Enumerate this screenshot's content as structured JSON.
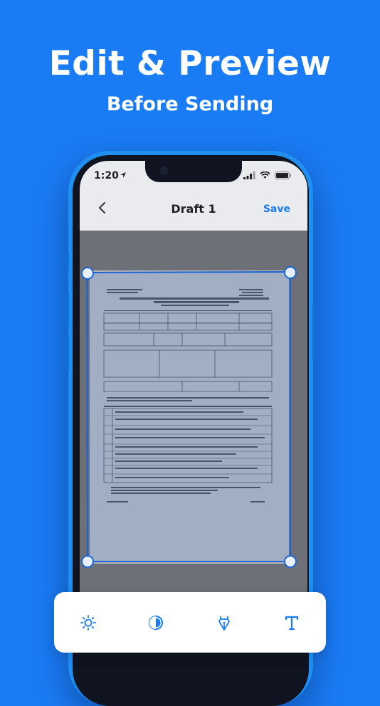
{
  "hero": {
    "title": "Edit & Preview",
    "subtitle": "Before Sending"
  },
  "status_bar": {
    "time": "1:20"
  },
  "nav": {
    "title": "Draft 1",
    "save_label": "Save"
  },
  "toolbar": {
    "tools": [
      {
        "icon": "brightness-icon"
      },
      {
        "icon": "contrast-icon"
      },
      {
        "icon": "pen-icon"
      },
      {
        "icon": "text-icon"
      }
    ]
  },
  "colors": {
    "background": "#1a7cf5",
    "accent": "#1a7cf5",
    "toolbar_icon": "#1a7cf5"
  }
}
